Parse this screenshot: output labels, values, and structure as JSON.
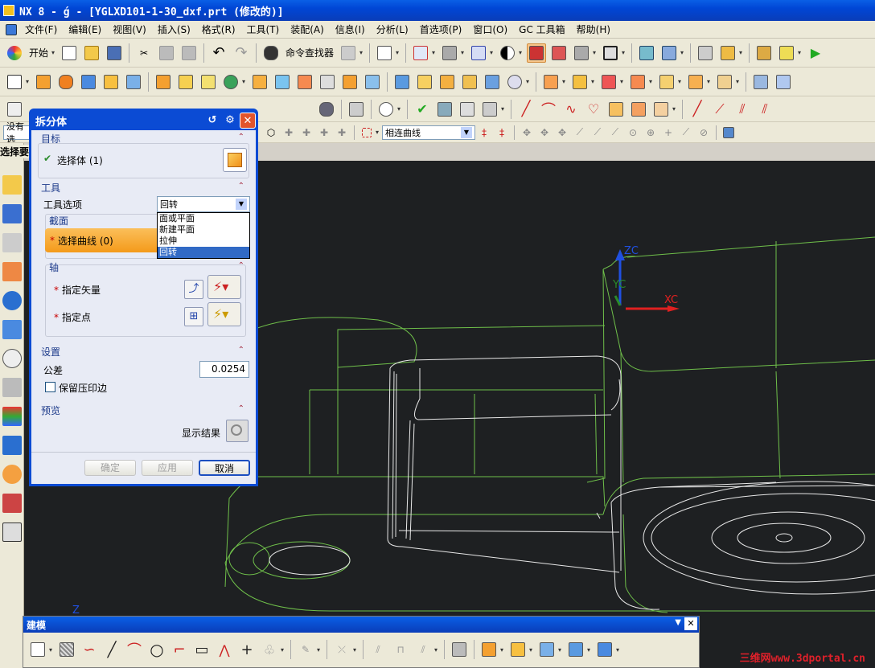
{
  "window": {
    "title": "NX 8 - ́g - [YGLXD101-1-30_dxf.prt (修改的)]"
  },
  "menubar": {
    "items": [
      "文件(F)",
      "编辑(E)",
      "视图(V)",
      "插入(S)",
      "格式(R)",
      "工具(T)",
      "装配(A)",
      "信息(I)",
      "分析(L)",
      "首选项(P)",
      "窗口(O)",
      "GC 工具箱",
      "帮助(H)"
    ]
  },
  "toolbar": {
    "start_label": "开始",
    "command_finder_label": "命令查找器",
    "filter_value": "没有选",
    "curve_rule_value": "相连曲线"
  },
  "side": {
    "selection_label": "选择要"
  },
  "dialog": {
    "title": "拆分体",
    "target": {
      "header": "目标",
      "select_body": "选择体 (1)"
    },
    "tool": {
      "header": "工具",
      "option_label": "工具选项",
      "option_value": "回转",
      "options": [
        "面或平面",
        "新建平面",
        "拉伸",
        "回转"
      ],
      "section_header": "截面",
      "select_curve": "选择曲线 (0)"
    },
    "axis": {
      "header": "轴",
      "specify_vector": "指定矢量",
      "specify_point": "指定点"
    },
    "settings": {
      "header": "设置",
      "tolerance_label": "公差",
      "tolerance_value": "0.0254",
      "keep_imprint": "保留压印边"
    },
    "preview": {
      "header": "预览",
      "show_result": "显示结果"
    },
    "buttons": {
      "ok": "确定",
      "apply": "应用",
      "cancel": "取消"
    }
  },
  "viewport": {
    "axis_labels": {
      "x": "XC",
      "y": "YC",
      "z": "ZC",
      "origin": "Z"
    },
    "colors": {
      "background": "#1e2022",
      "edge_green": "#6fbf4a",
      "edge_white": "#e8e8e8",
      "x_axis": "#e02020",
      "z_axis": "#2050e0"
    }
  },
  "modeling_toolbar": {
    "title": "建模"
  },
  "watermark": "三维网www.3dportal.cn"
}
